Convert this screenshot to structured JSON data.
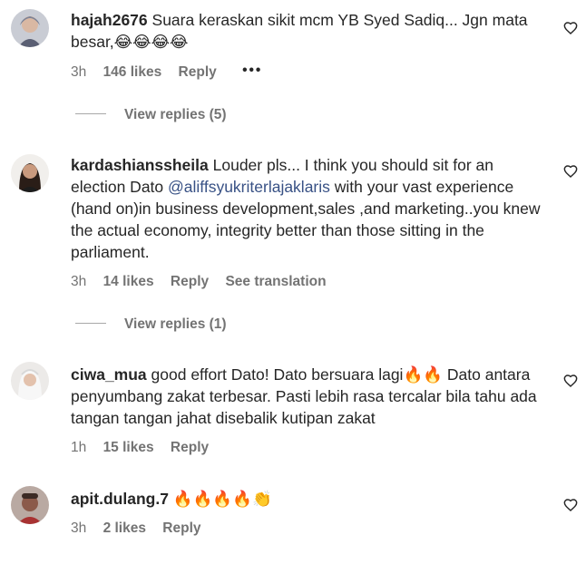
{
  "comments": [
    {
      "username": "hajah2676",
      "text": "Suara keraskan sikit mcm YB Syed Sadiq... Jgn mata besar,😂😂😂😂",
      "time": "3h",
      "likes": "146 likes",
      "reply": "Reply",
      "more": "•••",
      "view_replies": "View replies (5)"
    },
    {
      "username": "kardashianssheila",
      "text_before": "Louder pls... I think you should sit for an election Dato ",
      "mention": "@aliffsyukriterlajaklaris",
      "text_after": " with your vast experience (hand on)in business development,sales ,and marketing..you knew the actual economy, integrity better than those sitting in the parliament.",
      "time": "3h",
      "likes": "14 likes",
      "reply": "Reply",
      "translation": "See translation",
      "view_replies": "View replies (1)"
    },
    {
      "username": "ciwa_mua",
      "text": "good effort Dato! Dato bersuara lagi🔥🔥 Dato antara penyumbang zakat terbesar. Pasti lebih rasa tercalar bila tahu ada tangan tangan jahat disebalik kutipan zakat",
      "time": "1h",
      "likes": "15 likes",
      "reply": "Reply"
    },
    {
      "username": "apit.dulang.7",
      "text": "🔥🔥🔥🔥👏",
      "time": "3h",
      "likes": "2 likes",
      "reply": "Reply"
    }
  ],
  "icons": {
    "heart": "heart-outline-icon",
    "more": "more-options-icon"
  },
  "colors": {
    "text": "#262626",
    "secondary": "#737373",
    "mention": "#385185"
  }
}
